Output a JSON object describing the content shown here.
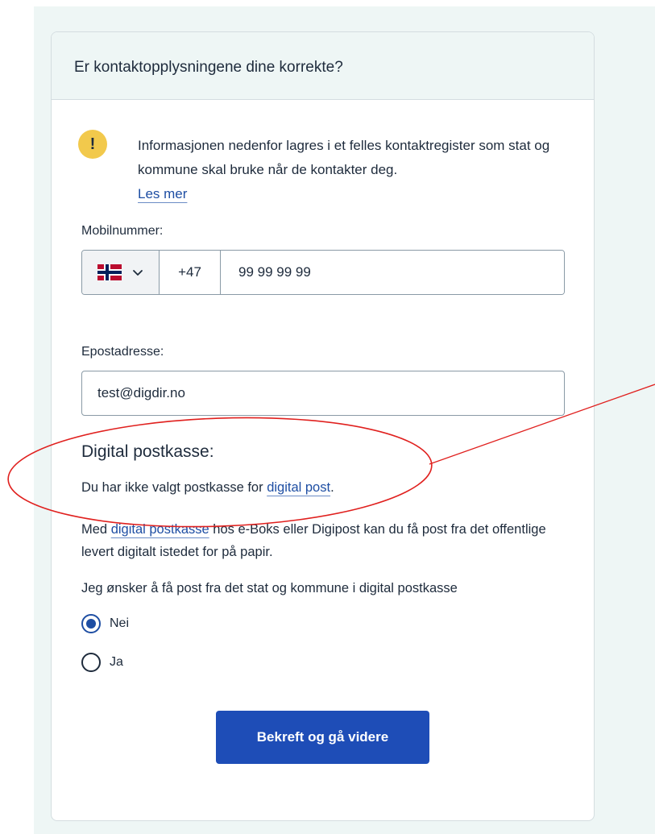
{
  "card": {
    "title": "Er kontaktopplysningene dine korrekte?"
  },
  "notice": {
    "icon": "exclamation-icon",
    "icon_symbol": "!",
    "text": "Informasjonen nedenfor lagres i et felles kontaktregister som stat og kommune skal bruke når de kontakter deg.",
    "link": "Les mer"
  },
  "phone": {
    "label": "Mobilnummer:",
    "country_flag": "norway-flag-icon",
    "prefix": "+47",
    "value": "99 99 99 99"
  },
  "email": {
    "label": "Epostadresse:",
    "value": "test@digdir.no"
  },
  "digital_mailbox": {
    "heading": "Digital postkasse:",
    "status_text": "Du har ikke valgt postkasse for ",
    "status_link": "digital post",
    "status_end": ".",
    "info_prefix": "Med ",
    "info_link": "digital postkasse",
    "info_suffix": " hos e-Boks eller Digipost kan du få post fra det offentlige levert digitalt istedet for på papir.",
    "question": "Jeg ønsker å få post fra det stat og kommune i digital postkasse",
    "options": [
      {
        "label": "Nei",
        "checked": true
      },
      {
        "label": "Ja",
        "checked": false
      }
    ]
  },
  "actions": {
    "submit_label": "Bekreft og gå videre"
  },
  "colors": {
    "accent": "#1e4db7",
    "link": "#1e4ea3",
    "warning": "#f2c94c",
    "annotation": "#e0201e",
    "header_bg": "#eef6f5"
  }
}
